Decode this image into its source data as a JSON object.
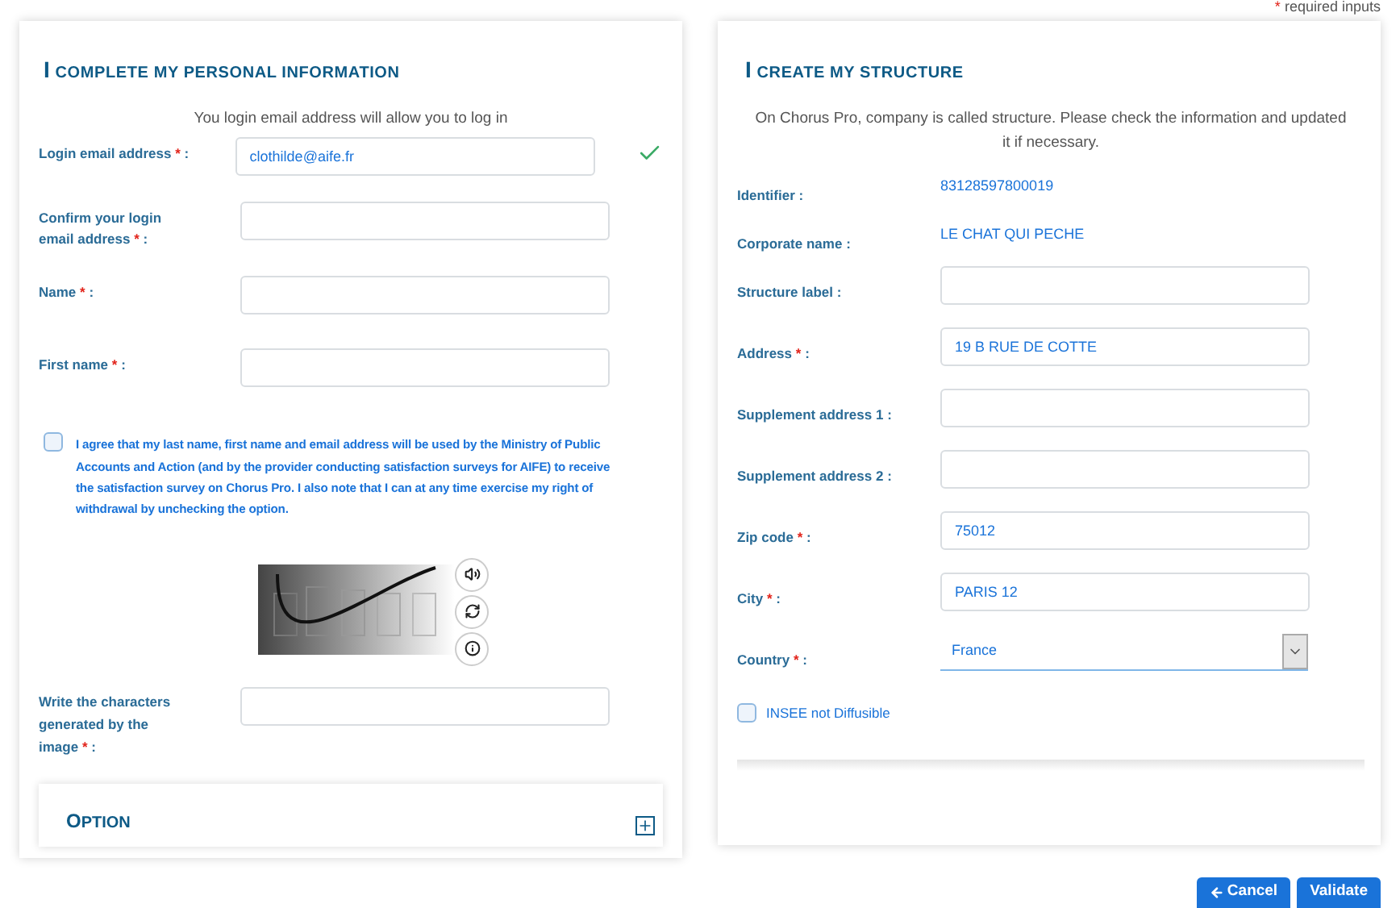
{
  "required_note": {
    "mark": "*",
    "text": "required inputs"
  },
  "personal": {
    "title": "I COMPLETE MY PERSONAL INFORMATION",
    "intro": "You login email address will allow you to log in",
    "fields": [
      {
        "label": "Login email address",
        "mark": "*",
        "suffix": ":",
        "value": "clothilde@aife.fr",
        "valid": true
      },
      {
        "label": "Confirm your login email address",
        "mark": "*",
        "suffix": ":",
        "valid": false
      },
      {
        "label": "Name",
        "mark": "*",
        "suffix": ":",
        "valid": false
      },
      {
        "label": "First name",
        "mark": "*",
        "suffix": ":",
        "valid": false
      }
    ],
    "consent": {
      "checked": false,
      "text": "I agree that my last name, first name and email address will be used by the Ministry of Public Accounts and Action (and by the provider conducting satisfaction surveys for AIFE) to receive the satisfaction survey on Chorus Pro. I also note that I can at any time exercise my right of withdrawal by unchecking the option."
    },
    "captcha": {
      "field": {
        "label": "Write the characters generated by the image",
        "mark": "*",
        "suffix": ":"
      }
    },
    "option": {
      "title": "OPTION",
      "expanded": false
    }
  },
  "structure": {
    "title": "I CREATE MY STRUCTURE",
    "intro": "On Chorus Pro, company is called structure. Please check the information and updated it if necessary.",
    "rows": [
      {
        "kind": "static",
        "label": "Identifier",
        "suffix": ":",
        "value": "83128597800019"
      },
      {
        "kind": "static",
        "label": "Corporate name",
        "suffix": ":",
        "value": "LE CHAT QUI PECHE"
      },
      {
        "kind": "input",
        "label": "Structure label",
        "suffix": ":"
      },
      {
        "kind": "input",
        "label": "Address",
        "mark": "*",
        "suffix": ":",
        "value": "19 B RUE DE COTTE"
      },
      {
        "kind": "input",
        "label": "Supplement address 1",
        "suffix": ":"
      },
      {
        "kind": "input",
        "label": "Supplement address 2",
        "suffix": ":"
      },
      {
        "kind": "input",
        "label": "Zip code",
        "mark": "*",
        "suffix": ":",
        "value": "75012"
      },
      {
        "kind": "input",
        "label": "City",
        "mark": "*",
        "suffix": ":",
        "value": "PARIS 12"
      },
      {
        "kind": "select",
        "label": "Country",
        "mark": "*",
        "suffix": ":",
        "value": "France"
      }
    ],
    "insee": {
      "checked": false,
      "label": "INSEE not Diffusible"
    }
  },
  "buttons": [
    {
      "kind": "back",
      "label": "Cancel"
    },
    {
      "kind": "primary",
      "label": "Validate"
    }
  ]
}
